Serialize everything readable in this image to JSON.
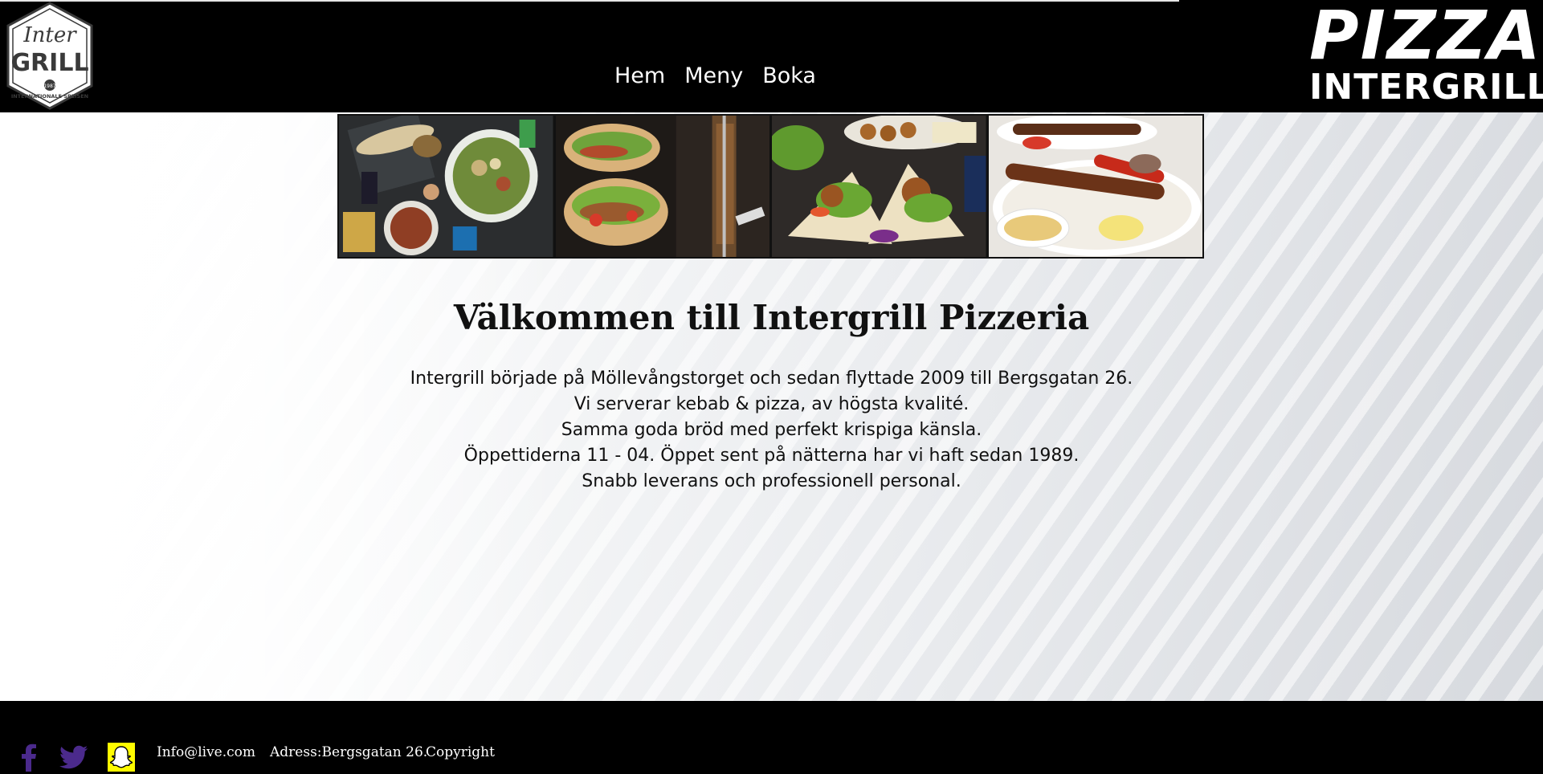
{
  "header": {
    "logo": {
      "text_top": "Inter",
      "text_bottom": "GRILL",
      "year": "1987",
      "ring_text": "INTERNATIONALE SPEISEN"
    },
    "nav": [
      {
        "label": "Hem"
      },
      {
        "label": "Meny"
      },
      {
        "label": "Boka"
      }
    ],
    "brand": {
      "line1": "PIZZA",
      "line2": "INTERGRILL"
    }
  },
  "gallery": {
    "photos": [
      "wrap-and-salad-photo",
      "kebab-and-doner-photo",
      "falafel-wrap-photo",
      "kebab-plate-photo"
    ]
  },
  "main": {
    "title": "Välkommen till Intergrill Pizzeria",
    "lines": [
      "Intergrill började på Möllevångstorget och sedan flyttade 2009 till Bergsgatan 26.",
      "Vi serverar kebab & pizza, av högsta kvalité.",
      "Samma goda bröd med perfekt krispiga känsla.",
      "Öppettiderna 11 - 04. Öppet sent på nätterna har vi haft sedan 1989.",
      "Snabb leverans och professionell personal."
    ]
  },
  "footer": {
    "social": [
      "facebook-icon",
      "twitter-icon",
      "snapchat-icon"
    ],
    "email": "Info@live.com",
    "address": "Adress:Bergsgatan 26.",
    "copyright": "Copyright"
  },
  "colors": {
    "header_bg": "#000000",
    "footer_bg": "#000000",
    "social_purple": "#4b2a8c",
    "snapchat_yellow": "#fffc00"
  }
}
